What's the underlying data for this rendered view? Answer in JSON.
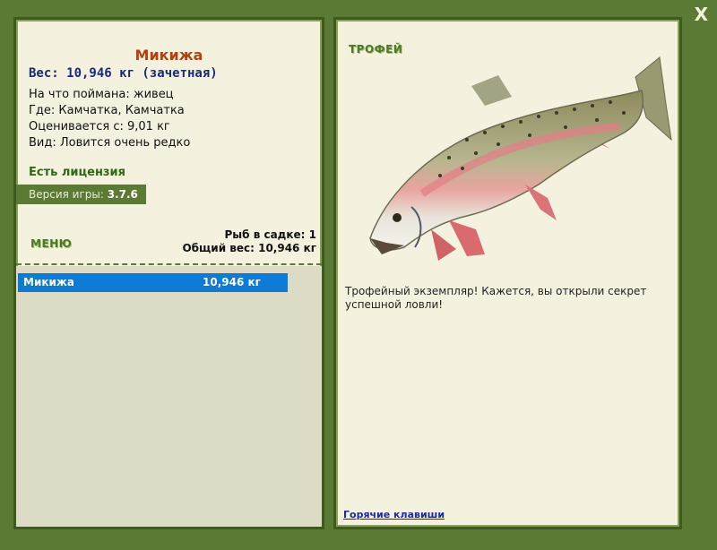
{
  "close_label": "X",
  "fish": {
    "name": "Микижа",
    "weight_line": "Вес: 10,946 кг (зачетная)",
    "caught_on": "На что поймана: живец",
    "location": "Где: Камчатка, Камчатка",
    "estimated_from": "Оценивается с: 9,01 кг",
    "rarity": "Вид: Ловится очень редко"
  },
  "license_label": "Есть лицензия",
  "version_prefix": "Версия игры:",
  "version_number": "3.7.6",
  "menu_label": "МЕНЮ",
  "cage": {
    "count_line": "Рыб в садке: 1",
    "total_line": "Общий вес: 10,946 кг"
  },
  "catch_list": [
    {
      "name": "Микижа",
      "weight": "10,946 кг"
    }
  ],
  "trophy_label": "ТРОФЕЙ",
  "trophy_description": "Трофейный экземпляр! Кажется, вы открыли секрет успешной ловли!",
  "hotkeys_label": "Горячие клавиши",
  "colors": {
    "background": "#5b7a34",
    "panel": "#f4f2de",
    "title": "#b5400e",
    "selection": "#0d7ad6"
  }
}
